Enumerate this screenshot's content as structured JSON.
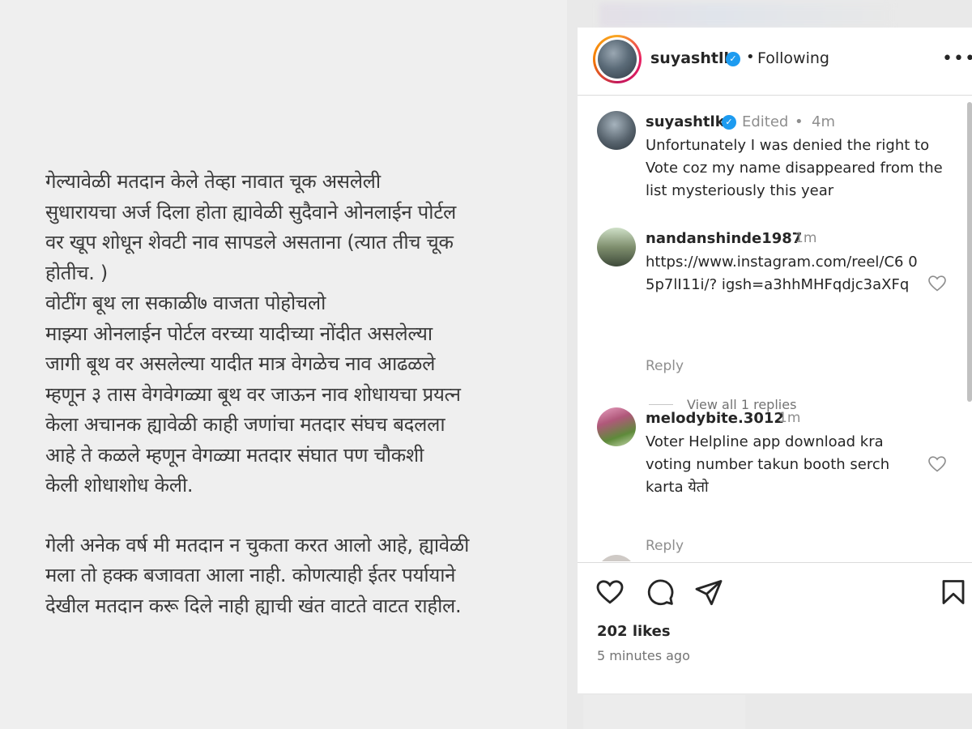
{
  "post_image": {
    "paragraph1": [
      "गेल्यावेळी मतदान केले तेव्हा नावात चूक असलेली",
      "सुधारायचा अर्ज दिला होता ह्यावेळी सुदैवाने ओनलाईन पोर्टल",
      "वर खूप शोधून शेवटी नाव सापडले असताना (त्यात तीच चूक",
      "होतीच. )",
      "वोटींग बूथ ला सकाळी७ वाजता पोहोचलो",
      "माझ्या ओनलाईन पोर्टल वरच्या यादीच्या नोंदीत असलेल्या",
      "जागी बूथ वर असलेल्या यादीत मात्र वेगळेच नाव आढळले",
      "म्हणून ३ तास वेगवेगळ्या बूथ वर जाऊन नाव शोधायचा प्रयत्न",
      "केला अचानक ह्यावेळी काही जणांचा मतदार संघच बदलला",
      "आहे ते कळले म्हणून वेगळ्या मतदार संघात पण चौकशी",
      "केली शोधाशोध केली."
    ],
    "paragraph2": [
      "गेली अनेक वर्ष मी मतदान न चुकता करत आलो आहे, ह्यावेळी",
      "मला तो हक्क बजावता आला नाही. कोणत्याही ईतर पर्यायाने",
      "देखील मतदान करू दिले नाही ह्याची खंत वाटते वाटत राहील."
    ]
  },
  "header": {
    "username": "suyashtlk",
    "dot": "•",
    "following": "Following",
    "more": "•••"
  },
  "comments": [
    {
      "username": "suyashtlk",
      "verified": true,
      "edited": "Edited",
      "dot": "•",
      "time": "4m",
      "text": "Unfortunately I was denied the right to Vote coz my name disappeared from the list mysteriously this year"
    },
    {
      "username": "nandanshinde1987",
      "time": "1m",
      "text": "https://www.instagram.com/reel/C6 05p7lI11i/? igsh=a3hhMHFqdjc3aXFq",
      "reply": "Reply",
      "view_replies": "View all 1 replies"
    },
    {
      "username": "melodybite.3012",
      "time": "1m",
      "text": "Voter Helpline app download kra voting number takun booth serch karta येतो",
      "reply": "Reply"
    }
  ],
  "footer": {
    "likes": "202 likes",
    "ago": "5 minutes ago"
  },
  "icons": {
    "like": "heart-icon",
    "comment": "comment-icon",
    "share": "share-icon",
    "save": "bookmark-icon",
    "verified": "verified-badge-icon"
  },
  "colors": {
    "verified": "#1d9bf0",
    "muted": "#8e8e8e",
    "text": "#262626"
  }
}
